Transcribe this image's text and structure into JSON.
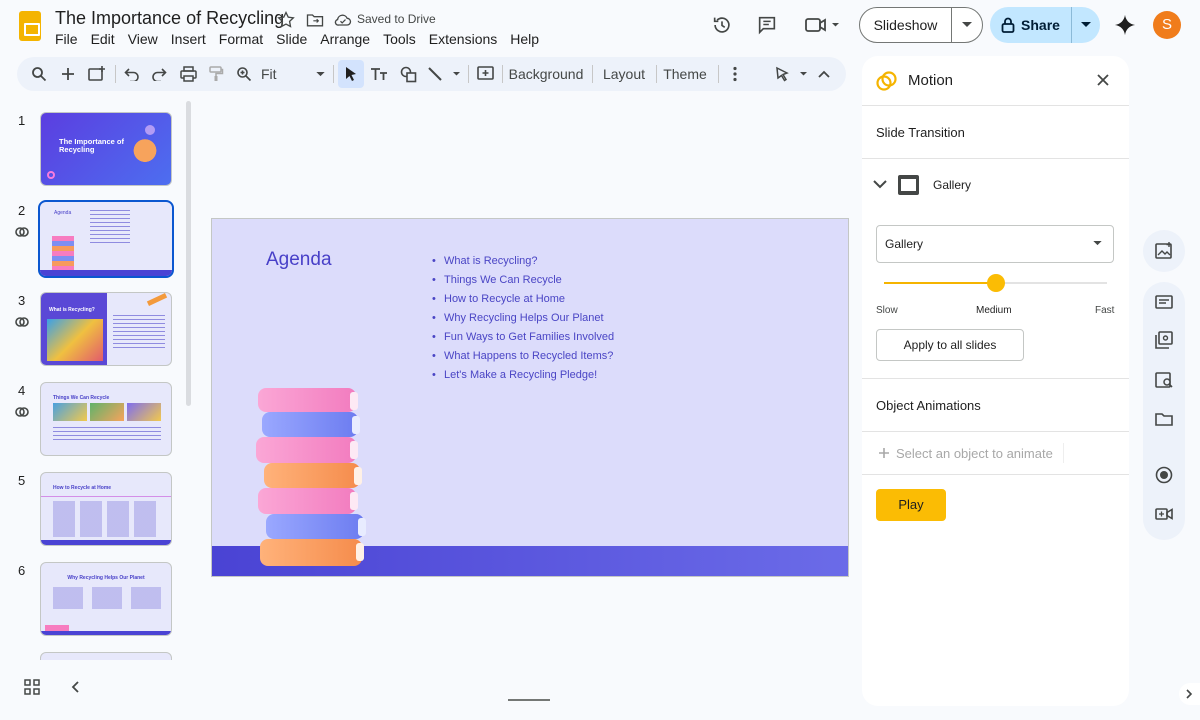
{
  "header": {
    "title": "The Importance of Recycling",
    "saved_status": "Saved to Drive",
    "menu": [
      "File",
      "Edit",
      "View",
      "Insert",
      "Format",
      "Slide",
      "Arrange",
      "Tools",
      "Extensions",
      "Help"
    ],
    "slideshow_label": "Slideshow",
    "share_label": "Share",
    "avatar_initial": "S"
  },
  "toolbar": {
    "zoom": "Fit",
    "background": "Background",
    "layout": "Layout",
    "theme": "Theme"
  },
  "slides": [
    {
      "number": "1",
      "title": "The Importance of Recycling"
    },
    {
      "number": "2",
      "title": "Agenda",
      "selected": true
    },
    {
      "number": "3",
      "title": "What is Recycling?"
    },
    {
      "number": "4",
      "title": "Things We Can Recycle"
    },
    {
      "number": "5",
      "title": "How to Recycle at Home"
    },
    {
      "number": "6",
      "title": "Why Recycling Helps Our Planet"
    }
  ],
  "current_slide": {
    "heading": "Agenda",
    "items": [
      "What is Recycling?",
      "Things We Can Recycle",
      "How to Recycle at Home",
      "Why Recycling Helps Our Planet",
      "Fun Ways to Get Families Involved",
      "What Happens to Recycled Items?",
      "Let's Make a Recycling Pledge!"
    ]
  },
  "motion_panel": {
    "title": "Motion",
    "slide_transition": "Slide Transition",
    "transition_name": "Gallery",
    "dropdown_value": "Gallery",
    "speed_labels": {
      "slow": "Slow",
      "medium": "Medium",
      "fast": "Fast"
    },
    "speed_level": 0.5,
    "apply_all": "Apply to all slides",
    "object_animations": "Object Animations",
    "select_object": "Select an object to animate",
    "play": "Play"
  },
  "colors": {
    "accent": "#0b57d0",
    "play": "#fbbc04",
    "slide_text": "#4840c8"
  }
}
